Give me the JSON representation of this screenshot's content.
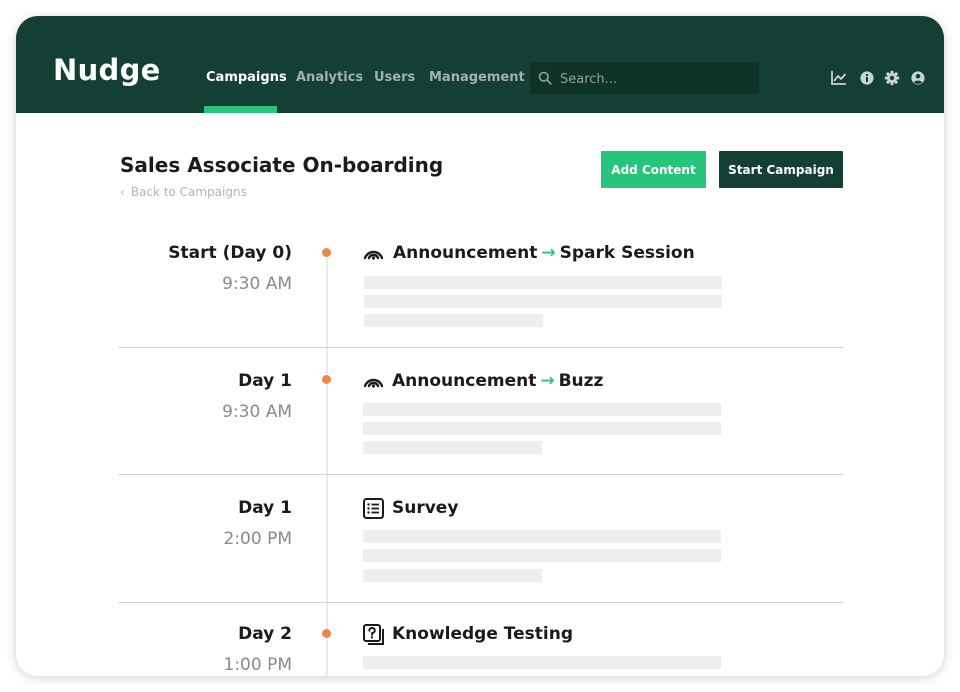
{
  "app": {
    "logo": "Nudge"
  },
  "nav": {
    "items": [
      {
        "label": "Campaigns",
        "active": true
      },
      {
        "label": "Analytics",
        "active": false
      },
      {
        "label": "Users",
        "active": false
      },
      {
        "label": "Management",
        "active": false
      }
    ]
  },
  "search": {
    "placeholder": "Search...",
    "value": ""
  },
  "toolbar_icons": [
    "chart-icon",
    "info-icon",
    "gear-icon",
    "user-icon"
  ],
  "page": {
    "title": "Sales Associate On-boarding",
    "back_link": "Back to Campaigns",
    "add_content_label": "Add Content",
    "start_campaign_label": "Start Campaign"
  },
  "timeline": [
    {
      "day": "Start (Day 0)",
      "time": "9:30 AM",
      "icon": "broadcast-icon",
      "title": "Announcement",
      "target": "Spark Session"
    },
    {
      "day": "Day 1",
      "time": "9:30 AM",
      "icon": "broadcast-icon",
      "title": "Announcement",
      "target": "Buzz"
    },
    {
      "day": "Day 1",
      "time": "2:00 PM",
      "icon": "list-icon",
      "title": "Survey",
      "target": ""
    },
    {
      "day": "Day 2",
      "time": "1:00 PM",
      "icon": "question-icon",
      "title": "Knowledge Testing",
      "target": ""
    }
  ],
  "colors": {
    "header_bg": "#133f35",
    "accent_green": "#27c57c",
    "timeline_dot": "#f0874a",
    "placeholder_bar": "#eeeeee"
  }
}
